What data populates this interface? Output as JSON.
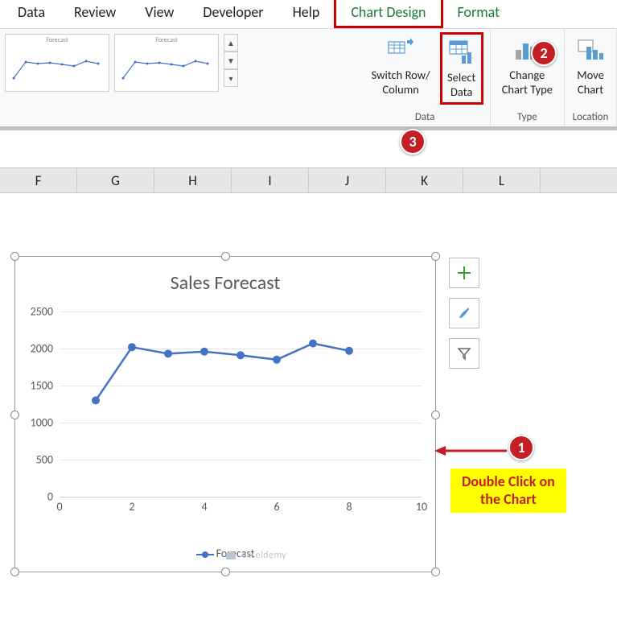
{
  "ribbon": {
    "tabs": [
      "Data",
      "Review",
      "View",
      "Developer",
      "Help",
      "Chart Design",
      "Format"
    ],
    "active_tab": "Chart Design",
    "style_thumb_title": "Forecast",
    "buttons": {
      "switch_row_top": "Switch Row/",
      "switch_row_bot": "Column",
      "select_data_top": "Select",
      "select_data_bot": "Data",
      "change_type_top": "Change",
      "change_type_bot": "Chart Type",
      "move_chart_top": "Move",
      "move_chart_bot": "Chart"
    },
    "groups": {
      "data": "Data",
      "type": "Type",
      "location": "Location"
    }
  },
  "columns": [
    "F",
    "G",
    "H",
    "I",
    "J",
    "K",
    "L"
  ],
  "chart_data": {
    "type": "line",
    "title": "Sales Forecast",
    "series": [
      {
        "name": "Forecast",
        "x": [
          1,
          2,
          3,
          4,
          5,
          6,
          7,
          8
        ],
        "values": [
          1300,
          2020,
          1930,
          1960,
          1910,
          1850,
          2070,
          1970
        ]
      }
    ],
    "xlim": [
      0,
      10
    ],
    "ylim": [
      0,
      2500
    ],
    "y_ticks": [
      0,
      500,
      1000,
      1500,
      2000,
      2500
    ],
    "x_ticks": [
      0,
      2,
      4,
      6,
      8,
      10
    ],
    "legend": "Forecast"
  },
  "callouts": {
    "b1": "1",
    "b2": "2",
    "b3": "3",
    "label_top": "Double Click on",
    "label_bot": "the Chart"
  },
  "watermark": "exceldemy"
}
